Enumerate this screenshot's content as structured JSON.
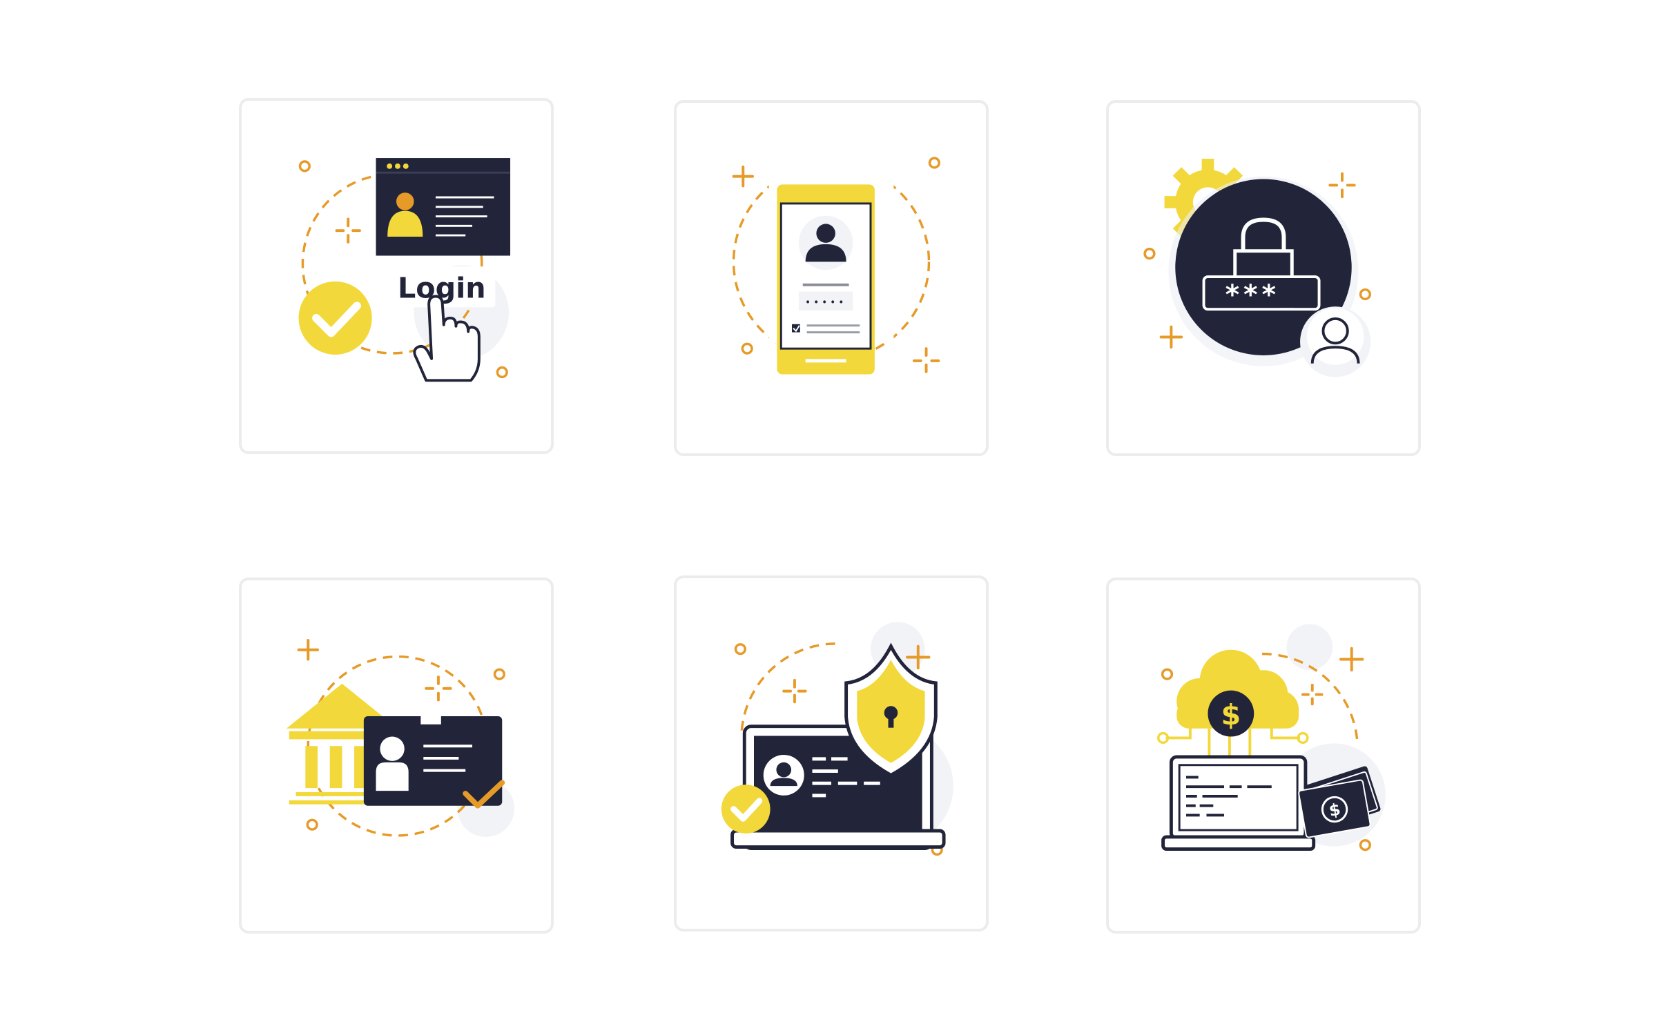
{
  "colors": {
    "yellow": "#f2d83a",
    "orange": "#e69a27",
    "navy": "#22253a",
    "bubble": "#f2f3f7",
    "card_border": "#ececed",
    "background": "#ffffff"
  },
  "cards": [
    {
      "id": "login",
      "icon": "login-browser-icon",
      "button_label": "Login"
    },
    {
      "id": "mobile-login",
      "icon": "mobile-profile-login-icon",
      "pin_mask": "•••••"
    },
    {
      "id": "password",
      "icon": "password-lock-icon",
      "password_mask": "***_"
    },
    {
      "id": "bank-id",
      "icon": "bank-id-card-icon"
    },
    {
      "id": "secure-laptop",
      "icon": "laptop-shield-icon"
    },
    {
      "id": "cloud-payment",
      "icon": "cloud-payment-icon",
      "currency_symbol": "$"
    }
  ]
}
